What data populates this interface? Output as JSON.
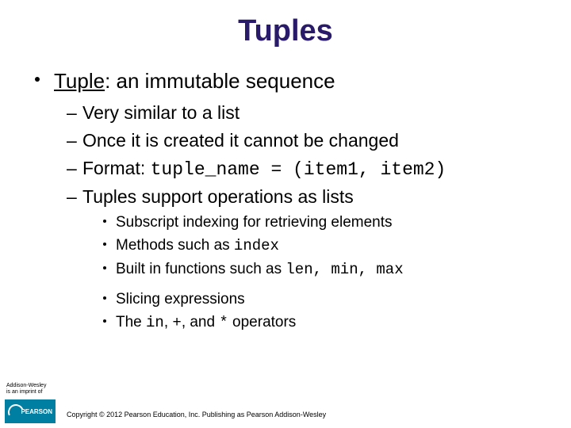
{
  "title": "Tuples",
  "bullet1": {
    "term": "Tuple",
    "rest": ": an immutable sequence"
  },
  "sub": {
    "a": "Very similar to a list",
    "b": "Once it is created it cannot be changed",
    "c_prefix": "Format: ",
    "c_code": "tuple_name = (item1, item2)",
    "d": "Tuples support operations as lists"
  },
  "ops": {
    "a": "Subscript indexing for retrieving elements",
    "b_prefix": "Methods such as ",
    "b_code": "index",
    "c_prefix": "Built in functions such as ",
    "c_code": "len, min, max",
    "d": "Slicing expressions",
    "e_prefix": "The ",
    "e_code1": "in",
    "e_mid1": ", ",
    "e_code2": "+",
    "e_mid2": ", and ",
    "e_code3": "*",
    "e_suffix": " operators"
  },
  "imprint": {
    "line1": "Addison-Wesley",
    "line2": "is an imprint of"
  },
  "logo": "PEARSON",
  "copyright": "Copyright © 2012 Pearson Education, Inc. Publishing as Pearson Addison-Wesley"
}
